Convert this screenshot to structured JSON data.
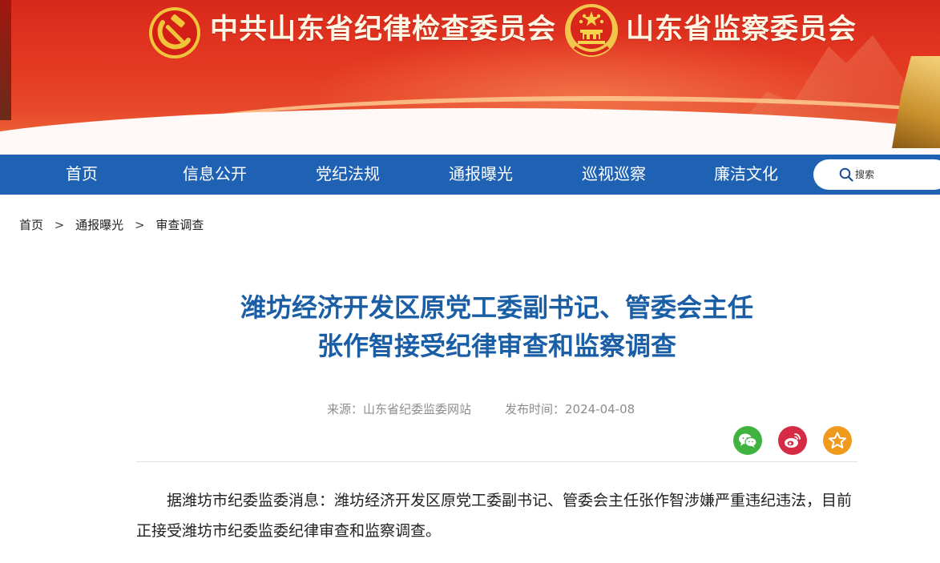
{
  "banner": {
    "org_party": "中共山东省纪律检查委员会",
    "org_state": "山东省监察委员会"
  },
  "nav": {
    "items": [
      "首页",
      "信息公开",
      "党纪法规",
      "通报曝光",
      "巡视巡察",
      "廉洁文化"
    ]
  },
  "search": {
    "placeholder": "搜索",
    "icon": "search-icon"
  },
  "breadcrumb": {
    "items": [
      "首页",
      "通报曝光",
      "审查调查"
    ],
    "separator": ">"
  },
  "article": {
    "title_line1": "潍坊经济开发区原党工委副书记、管委会主任",
    "title_line2": "张作智接受纪律审查和监察调查",
    "source": "来源：山东省纪委监委网站",
    "published": "发布时间：2024-04-08",
    "body": "据潍坊市纪委监委消息：潍坊经济开发区原党工委副书记、管委会主任张作智涉嫌严重违纪违法，目前正接受潍坊市纪委监委纪律审查和监察调查。"
  },
  "share": {
    "icons": [
      "wechat-icon",
      "weibo-icon",
      "favorite-icon"
    ],
    "colors": {
      "wechat": "#3fb23f",
      "weibo": "#d52b45",
      "favorite": "#ef9a1c"
    }
  },
  "colors": {
    "nav_bg": "#1f62b4",
    "title": "#1a5ea6",
    "banner_red": "#e53a22"
  }
}
